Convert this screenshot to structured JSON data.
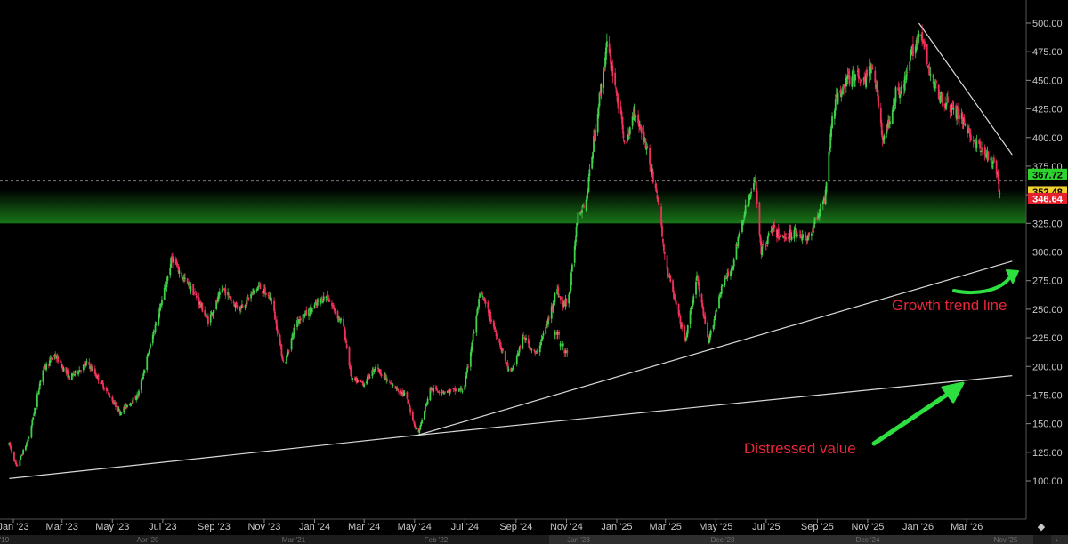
{
  "chart_data": {
    "type": "candlestick",
    "grid": false,
    "ylim": [
      88,
      510
    ],
    "y_ticks": [
      100,
      125,
      150,
      175,
      200,
      225,
      250,
      275,
      300,
      325,
      350,
      375,
      400,
      425,
      450,
      475,
      500
    ],
    "y_tick_labels": [
      "100.00",
      "125.00",
      "150.00",
      "175.00",
      "200.00",
      "225.00",
      "250.00",
      "275.00",
      "300.00",
      "325.00",
      "350.00",
      "375.00",
      "400.00",
      "425.00",
      "450.00",
      "475.00",
      "500.00"
    ],
    "x_ticks": [
      "Jan '23",
      "Mar '23",
      "May '23",
      "Jul '23",
      "Sep '23",
      "Nov '23",
      "Jan '24",
      "Mar '24",
      "May '24",
      "Jul '24",
      "Sep '24",
      "Nov '24",
      "Jan '25",
      "Mar '25",
      "May '25",
      "Jul '25",
      "Sep '25",
      "Nov '25",
      "Jan '26",
      "Mar '26"
    ],
    "price_path": [
      [
        "2022-12-27",
        132
      ],
      [
        "2023-01-05",
        112
      ],
      [
        "2023-01-20",
        138
      ],
      [
        "2023-02-05",
        196
      ],
      [
        "2023-02-20",
        210
      ],
      [
        "2023-03-10",
        190
      ],
      [
        "2023-04-01",
        203
      ],
      [
        "2023-04-20",
        183
      ],
      [
        "2023-05-10",
        160
      ],
      [
        "2023-06-01",
        175
      ],
      [
        "2023-06-20",
        230
      ],
      [
        "2023-07-05",
        272
      ],
      [
        "2023-07-12",
        295
      ],
      [
        "2023-07-25",
        278
      ],
      [
        "2023-08-10",
        262
      ],
      [
        "2023-08-25",
        240
      ],
      [
        "2023-09-12",
        268
      ],
      [
        "2023-10-01",
        250
      ],
      [
        "2023-10-25",
        270
      ],
      [
        "2023-11-10",
        258
      ],
      [
        "2023-11-25",
        200
      ],
      [
        "2023-12-10",
        240
      ],
      [
        "2023-12-25",
        248
      ],
      [
        "2024-01-15",
        262
      ],
      [
        "2024-02-05",
        235
      ],
      [
        "2024-02-15",
        188
      ],
      [
        "2024-03-01",
        185
      ],
      [
        "2024-03-15",
        200
      ],
      [
        "2024-04-01",
        185
      ],
      [
        "2024-04-20",
        175
      ],
      [
        "2024-05-05",
        140
      ],
      [
        "2024-05-20",
        180
      ],
      [
        "2024-06-10",
        178
      ],
      [
        "2024-06-30",
        180
      ],
      [
        "2024-07-20",
        265
      ],
      [
        "2024-08-10",
        225
      ],
      [
        "2024-08-25",
        192
      ],
      [
        "2024-09-10",
        226
      ],
      [
        "2024-09-25",
        210
      ],
      [
        "2024-10-10",
        240
      ],
      [
        "2024-10-20",
        268
      ],
      [
        "2024-10-28",
        252
      ],
      [
        "2024-11-05",
        265
      ],
      [
        "2024-11-15",
        335
      ],
      [
        "2024-11-25",
        345
      ],
      [
        "2024-12-08",
        420
      ],
      [
        "2024-12-20",
        480
      ],
      [
        "2024-12-28",
        455
      ],
      [
        "2025-01-12",
        390
      ],
      [
        "2025-01-22",
        425
      ],
      [
        "2025-02-05",
        395
      ],
      [
        "2025-02-20",
        345
      ],
      [
        "2025-03-01",
        290
      ],
      [
        "2025-03-15",
        250
      ],
      [
        "2025-03-25",
        222
      ],
      [
        "2025-04-08",
        278
      ],
      [
        "2025-04-22",
        220
      ],
      [
        "2025-05-08",
        270
      ],
      [
        "2025-05-20",
        285
      ],
      [
        "2025-06-05",
        335
      ],
      [
        "2025-06-18",
        362
      ],
      [
        "2025-06-25",
        300
      ],
      [
        "2025-07-08",
        320
      ],
      [
        "2025-07-20",
        312
      ],
      [
        "2025-08-05",
        318
      ],
      [
        "2025-08-20",
        310
      ],
      [
        "2025-09-01",
        332
      ],
      [
        "2025-09-10",
        345
      ],
      [
        "2025-09-20",
        425
      ],
      [
        "2025-10-01",
        445
      ],
      [
        "2025-10-15",
        455
      ],
      [
        "2025-10-28",
        450
      ],
      [
        "2025-11-08",
        465
      ],
      [
        "2025-11-20",
        395
      ],
      [
        "2025-12-05",
        440
      ],
      [
        "2025-12-15",
        445
      ],
      [
        "2025-12-25",
        475
      ],
      [
        "2026-01-02",
        490
      ],
      [
        "2026-01-08",
        480
      ],
      [
        "2026-01-15",
        455
      ],
      [
        "2026-01-25",
        440
      ],
      [
        "2026-02-10",
        425
      ],
      [
        "2026-02-25",
        415
      ],
      [
        "2026-03-10",
        395
      ],
      [
        "2026-03-25",
        385
      ],
      [
        "2026-04-05",
        372
      ],
      [
        "2026-04-10",
        352.48
      ]
    ],
    "price_gap_segments": [
      {
        "from": "2024-10-18",
        "to": "2024-11-02",
        "values": [
          228,
          218,
          212
        ]
      }
    ],
    "trendlines": [
      {
        "name": "Growth trend line",
        "points": [
          [
            "2024-05-05",
            140
          ],
          [
            "2026-04-25",
            292
          ]
        ],
        "color": "#d9d9d9"
      },
      {
        "name": "Distressed value",
        "points": [
          [
            "2022-12-27",
            102
          ],
          [
            "2024-05-05",
            140
          ],
          [
            "2026-04-25",
            192
          ]
        ],
        "color": "#d9d9d9"
      },
      {
        "name": "",
        "points": [
          [
            "2026-01-02",
            500
          ],
          [
            "2026-04-25",
            385
          ]
        ],
        "color": "#d9d9d9"
      }
    ],
    "zone": {
      "from": 325,
      "to": 355,
      "color": "#1d8a1d"
    },
    "reference_line": {
      "value": 362,
      "style": "dashed"
    },
    "price_labels": [
      {
        "value": 367.72,
        "text": "367.72",
        "bg": "#2ed12e",
        "fg": "#000000"
      },
      {
        "value": 352.48,
        "text": "352.48",
        "bg": "#f0d02e",
        "fg": "#000000"
      },
      {
        "value": 346.64,
        "text": "346.64",
        "bg": "#e6212e",
        "fg": "#ffffff"
      }
    ],
    "annotations": [
      {
        "text": "Growth trend line",
        "color": "#e8283a"
      },
      {
        "text": "Distressed value",
        "color": "#e8283a"
      }
    ],
    "navigator_labels": [
      "'19",
      "Apr '20",
      "Mar '21",
      "Feb '22",
      "Jan '23",
      "Dec '23",
      "Dec '24",
      "Nov '25"
    ],
    "colors": {
      "up": "#3fd14a",
      "down": "#f0305a",
      "arrow": "#2ee03f",
      "background": "#000000"
    }
  }
}
